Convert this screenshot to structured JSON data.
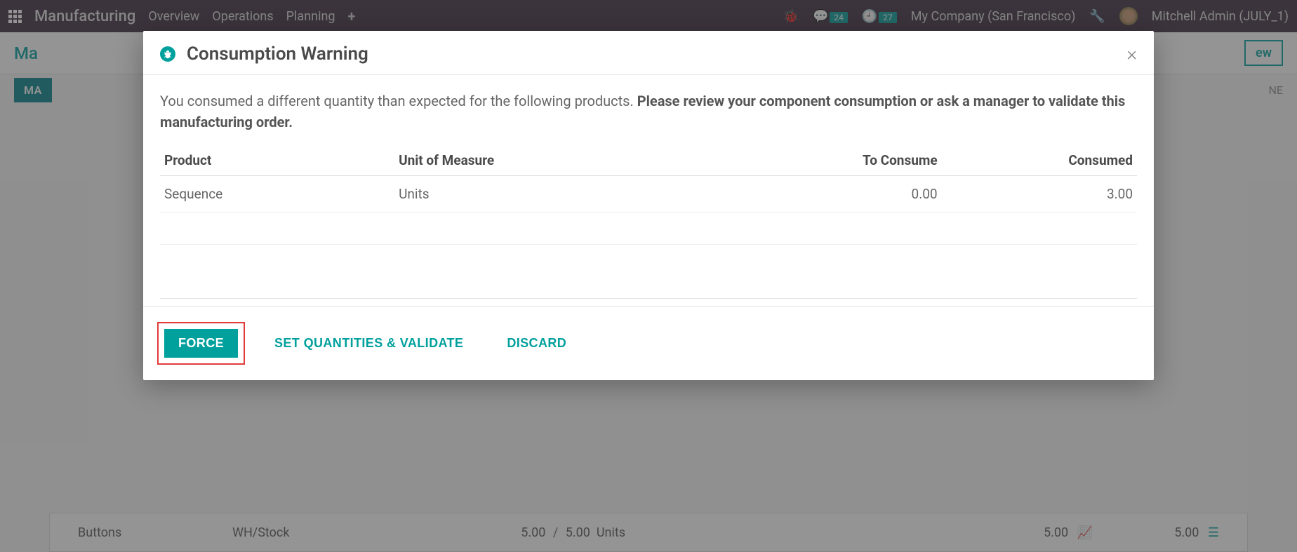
{
  "topbar": {
    "brand": "Manufacturing",
    "nav": [
      "Overview",
      "Operations",
      "Planning"
    ],
    "messages_badge": "24",
    "activities_badge": "27",
    "company": "My Company (San Francisco)",
    "user": "Mitchell Admin (JULY_1)"
  },
  "secondbar": {
    "breadcrumb_partial": "Ma",
    "new_partial": "ew"
  },
  "thirdrow": {
    "ma_partial": "MA",
    "ne_partial": "NE"
  },
  "modal": {
    "title": "Consumption Warning",
    "message_plain": "You consumed a different quantity than expected for the following products. ",
    "message_bold": "Please review your component consumption or ask a manager to validate this manufacturing order.",
    "columns": {
      "product": "Product",
      "uom": "Unit of Measure",
      "to_consume": "To Consume",
      "consumed": "Consumed"
    },
    "rows": [
      {
        "product": "Sequence",
        "uom": "Units",
        "to_consume": "0.00",
        "consumed": "3.00"
      }
    ],
    "buttons": {
      "force": "FORCE",
      "set_validate": "SET QUANTITIES & VALIDATE",
      "discard": "DISCARD"
    }
  },
  "bg_row": {
    "product": "Buttons",
    "location": "WH/Stock",
    "qty_a": "5.00",
    "qty_sep": "/",
    "qty_b": "5.00",
    "uom": "Units",
    "col4": "5.00",
    "col5": "5.00"
  }
}
